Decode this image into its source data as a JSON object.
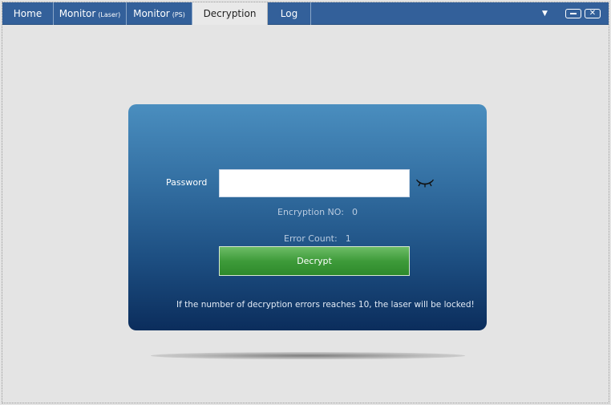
{
  "tabs": [
    {
      "label": "Home",
      "sub": ""
    },
    {
      "label": "Monitor",
      "sub": "(Laser)"
    },
    {
      "label": "Monitor",
      "sub": "(PS)"
    },
    {
      "label": "Decryption",
      "sub": ""
    },
    {
      "label": "Log",
      "sub": ""
    }
  ],
  "active_tab": "Decryption",
  "toolbar": {
    "dropdown_glyph": "▼",
    "close_glyph": "✕",
    "icons": [
      "dropdown-icon",
      "minimize-icon",
      "close-icon"
    ]
  },
  "panel": {
    "password_label": "Password",
    "password_value": "",
    "password_placeholder": "",
    "eye_icon": "closed-eye-icon",
    "encryption_label": "Encryption NO:",
    "encryption_value": "0",
    "error_label": "Error Count:",
    "error_value": "1",
    "decrypt_label": "Decrypt",
    "warning": "If the number of decryption errors reaches 10, the laser will be locked!"
  },
  "colors": {
    "tabbar": "#33609a",
    "panel_top": "#4a8ebf",
    "panel_bottom": "#0b2d5c",
    "button_green": "#3e9b3a"
  }
}
